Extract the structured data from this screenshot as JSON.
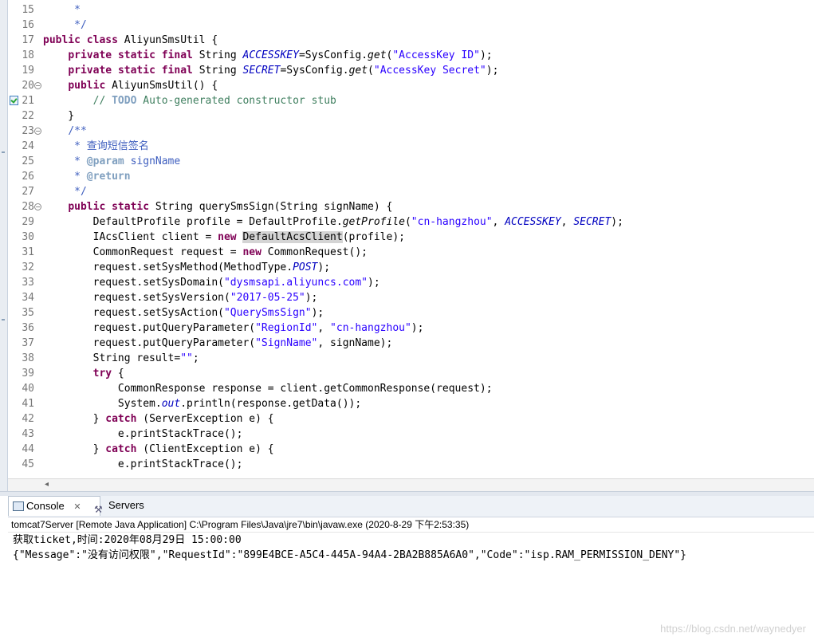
{
  "editor": {
    "lines": [
      {
        "n": "15",
        "parts": [
          {
            "t": "     *",
            "c": "jd"
          }
        ]
      },
      {
        "n": "16",
        "parts": [
          {
            "t": "     */",
            "c": "jd"
          }
        ]
      },
      {
        "n": "17",
        "parts": [
          {
            "t": "public",
            "c": "kw"
          },
          {
            "t": " "
          },
          {
            "t": "class",
            "c": "kw"
          },
          {
            "t": " AliyunSmsUtil {"
          }
        ]
      },
      {
        "n": "18",
        "parts": [
          {
            "t": "    "
          },
          {
            "t": "private",
            "c": "kw"
          },
          {
            "t": " "
          },
          {
            "t": "static",
            "c": "kw"
          },
          {
            "t": " "
          },
          {
            "t": "final",
            "c": "kw"
          },
          {
            "t": " String "
          },
          {
            "t": "ACCESSKEY",
            "c": "sf"
          },
          {
            "t": "=SysConfig."
          },
          {
            "t": "get",
            "c": "sm"
          },
          {
            "t": "("
          },
          {
            "t": "\"AccessKey ID\"",
            "c": "str"
          },
          {
            "t": ");"
          }
        ]
      },
      {
        "n": "19",
        "parts": [
          {
            "t": "    "
          },
          {
            "t": "private",
            "c": "kw"
          },
          {
            "t": " "
          },
          {
            "t": "static",
            "c": "kw"
          },
          {
            "t": " "
          },
          {
            "t": "final",
            "c": "kw"
          },
          {
            "t": " String "
          },
          {
            "t": "SECRET",
            "c": "sf"
          },
          {
            "t": "=SysConfig."
          },
          {
            "t": "get",
            "c": "sm"
          },
          {
            "t": "("
          },
          {
            "t": "\"AccessKey Secret\"",
            "c": "str"
          },
          {
            "t": ");"
          }
        ]
      },
      {
        "n": "20",
        "fold": true,
        "parts": [
          {
            "t": "    "
          },
          {
            "t": "public",
            "c": "kw"
          },
          {
            "t": " AliyunSmsUtil() {"
          }
        ]
      },
      {
        "n": "21",
        "task": true,
        "parts": [
          {
            "t": "        "
          },
          {
            "t": "// ",
            "c": "cm"
          },
          {
            "t": "TODO",
            "c": "todo"
          },
          {
            "t": " Auto-generated constructor stub",
            "c": "cm"
          }
        ]
      },
      {
        "n": "22",
        "parts": [
          {
            "t": "    }"
          }
        ]
      },
      {
        "n": "23",
        "fold": true,
        "parts": [
          {
            "t": "    "
          },
          {
            "t": "/**",
            "c": "jd"
          }
        ]
      },
      {
        "n": "24",
        "parts": [
          {
            "t": "     * 查询短信签名",
            "c": "jd"
          }
        ]
      },
      {
        "n": "25",
        "parts": [
          {
            "t": "     * ",
            "c": "jd"
          },
          {
            "t": "@param",
            "c": "jdtag"
          },
          {
            "t": " signName",
            "c": "jd"
          }
        ]
      },
      {
        "n": "26",
        "parts": [
          {
            "t": "     * ",
            "c": "jd"
          },
          {
            "t": "@return",
            "c": "jdtag"
          }
        ]
      },
      {
        "n": "27",
        "parts": [
          {
            "t": "     */",
            "c": "jd"
          }
        ]
      },
      {
        "n": "28",
        "fold": true,
        "parts": [
          {
            "t": "    "
          },
          {
            "t": "public",
            "c": "kw"
          },
          {
            "t": " "
          },
          {
            "t": "static",
            "c": "kw"
          },
          {
            "t": " String querySmsSign(String signName) {"
          }
        ]
      },
      {
        "n": "29",
        "parts": [
          {
            "t": "        DefaultProfile profile = DefaultProfile."
          },
          {
            "t": "getProfile",
            "c": "sm"
          },
          {
            "t": "("
          },
          {
            "t": "\"cn-hangzhou\"",
            "c": "str"
          },
          {
            "t": ", "
          },
          {
            "t": "ACCESSKEY",
            "c": "sf"
          },
          {
            "t": ", "
          },
          {
            "t": "SECRET",
            "c": "sf"
          },
          {
            "t": ");"
          }
        ]
      },
      {
        "n": "30",
        "parts": [
          {
            "t": "        IAcsClient client = "
          },
          {
            "t": "new",
            "c": "kw"
          },
          {
            "t": " "
          },
          {
            "t": "DefaultAcsClient",
            "c": "hl"
          },
          {
            "t": "(profile);"
          }
        ]
      },
      {
        "n": "31",
        "parts": [
          {
            "t": "        CommonRequest request = "
          },
          {
            "t": "new",
            "c": "kw"
          },
          {
            "t": " CommonRequest();"
          }
        ]
      },
      {
        "n": "32",
        "parts": [
          {
            "t": "        request.setSysMethod(MethodType."
          },
          {
            "t": "POST",
            "c": "sf"
          },
          {
            "t": ");"
          }
        ]
      },
      {
        "n": "33",
        "parts": [
          {
            "t": "        request.setSysDomain("
          },
          {
            "t": "\"dysmsapi.aliyuncs.com\"",
            "c": "str"
          },
          {
            "t": ");"
          }
        ]
      },
      {
        "n": "34",
        "parts": [
          {
            "t": "        request.setSysVersion("
          },
          {
            "t": "\"2017-05-25\"",
            "c": "str"
          },
          {
            "t": ");"
          }
        ]
      },
      {
        "n": "35",
        "parts": [
          {
            "t": "        request.setSysAction("
          },
          {
            "t": "\"QuerySmsSign\"",
            "c": "str"
          },
          {
            "t": ");"
          }
        ]
      },
      {
        "n": "36",
        "parts": [
          {
            "t": "        request.putQueryParameter("
          },
          {
            "t": "\"RegionId\"",
            "c": "str"
          },
          {
            "t": ", "
          },
          {
            "t": "\"cn-hangzhou\"",
            "c": "str"
          },
          {
            "t": ");"
          }
        ]
      },
      {
        "n": "37",
        "parts": [
          {
            "t": "        request.putQueryParameter("
          },
          {
            "t": "\"SignName\"",
            "c": "str"
          },
          {
            "t": ", signName);"
          }
        ]
      },
      {
        "n": "38",
        "parts": [
          {
            "t": "        String result="
          },
          {
            "t": "\"\"",
            "c": "str"
          },
          {
            "t": ";"
          }
        ]
      },
      {
        "n": "39",
        "parts": [
          {
            "t": "        "
          },
          {
            "t": "try",
            "c": "kw"
          },
          {
            "t": " {"
          }
        ]
      },
      {
        "n": "40",
        "parts": [
          {
            "t": "            CommonResponse response = client.getCommonResponse(request);"
          }
        ]
      },
      {
        "n": "41",
        "parts": [
          {
            "t": "            System."
          },
          {
            "t": "out",
            "c": "sf"
          },
          {
            "t": ".println(response.getData());"
          }
        ]
      },
      {
        "n": "42",
        "parts": [
          {
            "t": "        } "
          },
          {
            "t": "catch",
            "c": "kw"
          },
          {
            "t": " (ServerException e) {"
          }
        ]
      },
      {
        "n": "43",
        "parts": [
          {
            "t": "            e.printStackTrace();"
          }
        ]
      },
      {
        "n": "44",
        "parts": [
          {
            "t": "        } "
          },
          {
            "t": "catch",
            "c": "kw"
          },
          {
            "t": " (ClientException e) {"
          }
        ]
      },
      {
        "n": "45",
        "parts": [
          {
            "t": "            e.printStackTrace();"
          }
        ]
      }
    ]
  },
  "tabs": {
    "console_label": "Console",
    "console_close": "✕",
    "servers_label": "Servers"
  },
  "console": {
    "header": "tomcat7Server [Remote Java Application] C:\\Program Files\\Java\\jre7\\bin\\javaw.exe (2020-8-29 下午2:53:35)",
    "output": [
      "获取ticket,时间:2020年08月29日 15:00:00",
      "{\"Message\":\"没有访问权限\",\"RequestId\":\"899E4BCE-A5C4-445A-94A4-2BA2B885A6A0\",\"Code\":\"isp.RAM_PERMISSION_DENY\"}"
    ]
  },
  "watermark": "https://blog.csdn.net/waynedyer",
  "colors": {
    "keyword": "#7f0055",
    "string": "#2a00ff",
    "comment": "#3f7f5f",
    "javadoc": "#3f5fbf",
    "static_field": "#0000c0"
  }
}
